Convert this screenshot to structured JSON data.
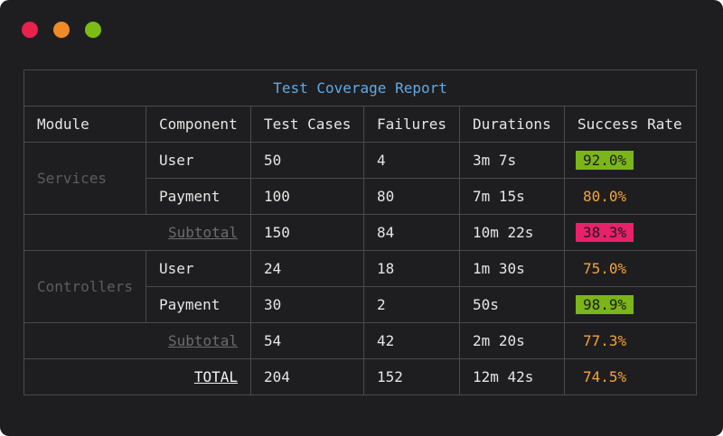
{
  "window": {
    "controls": [
      {
        "name": "close",
        "color": "#e8214d"
      },
      {
        "name": "minimize",
        "color": "#ef8a27"
      },
      {
        "name": "maximize",
        "color": "#7cbc14"
      }
    ]
  },
  "report": {
    "title": "Test Coverage Report",
    "headers": {
      "module": "Module",
      "component": "Component",
      "test_cases": "Test Cases",
      "failures": "Failures",
      "durations": "Durations",
      "success_rate": "Success Rate"
    },
    "groups": [
      {
        "module": "Services",
        "rows": [
          {
            "component": "User",
            "test_cases": "50",
            "failures": "4",
            "durations": "3m 7s",
            "success_rate": "92.0%",
            "status": "good"
          },
          {
            "component": "Payment",
            "test_cases": "100",
            "failures": "80",
            "durations": "7m 15s",
            "success_rate": "80.0%",
            "status": "warn"
          }
        ],
        "subtotal": {
          "label": "Subtotal",
          "test_cases": "150",
          "failures": "84",
          "durations": "10m 22s",
          "success_rate": "38.3%",
          "status": "bad"
        }
      },
      {
        "module": "Controllers",
        "rows": [
          {
            "component": "User",
            "test_cases": "24",
            "failures": "18",
            "durations": "1m 30s",
            "success_rate": "75.0%",
            "status": "warn"
          },
          {
            "component": "Payment",
            "test_cases": "30",
            "failures": "2",
            "durations": "50s",
            "success_rate": "98.9%",
            "status": "good"
          }
        ],
        "subtotal": {
          "label": "Subtotal",
          "test_cases": "54",
          "failures": "42",
          "durations": "2m 20s",
          "success_rate": "77.3%",
          "status": "warn"
        }
      }
    ],
    "total": {
      "label": "TOTAL",
      "test_cases": "204",
      "failures": "152",
      "durations": "12m 42s",
      "success_rate": "74.5%",
      "status": "warn"
    },
    "colors": {
      "good": "#7cb519",
      "bad": "#e8216b",
      "warn": "#f5a33a",
      "title": "#63a9e2"
    }
  }
}
